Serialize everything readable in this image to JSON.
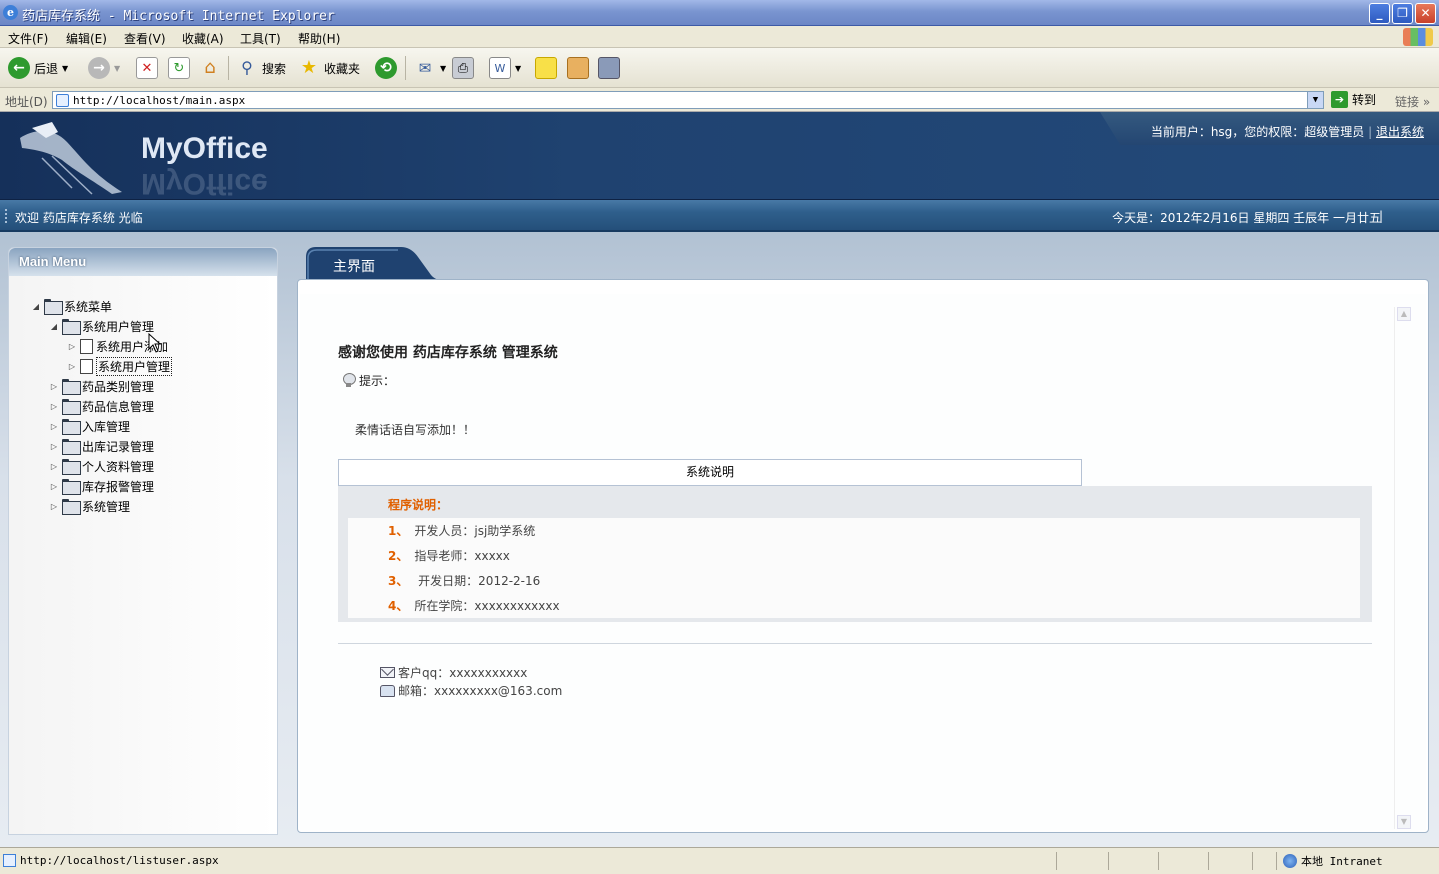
{
  "window": {
    "title": "药店库存系统 - Microsoft Internet Explorer"
  },
  "menubar": {
    "items": [
      "文件(F)",
      "编辑(E)",
      "查看(V)",
      "收藏(A)",
      "工具(T)",
      "帮助(H)"
    ]
  },
  "toolbar": {
    "back_label": "后退",
    "search_label": "搜索",
    "favorites_label": "收藏夹"
  },
  "address": {
    "label": "地址(D)",
    "url": "http://localhost/main.aspx",
    "go_label": "转到",
    "links_label": "链接"
  },
  "header": {
    "brand": "MyOffice",
    "user_info": "当前用户：hsg，您的权限：超级管理员",
    "logout_label": "退出系统"
  },
  "welcome": {
    "text": "欢迎 药店库存系统 光临",
    "date": "今天是：2012年2月16日 星期四 壬辰年 一月廿五"
  },
  "sidebar": {
    "title": "Main Menu",
    "tree": [
      {
        "label": "系统菜单"
      },
      {
        "label": "系统用户管理"
      },
      {
        "label": "系统用户添加"
      },
      {
        "label": "系统用户管理"
      },
      {
        "label": "药品类别管理"
      },
      {
        "label": "药品信息管理"
      },
      {
        "label": "入库管理"
      },
      {
        "label": "出库记录管理"
      },
      {
        "label": "个人资料管理"
      },
      {
        "label": "库存报警管理"
      },
      {
        "label": "系统管理"
      }
    ]
  },
  "main": {
    "tab_label": "主界面",
    "thanks": "感谢您使用 药店库存系统 管理系统",
    "tip_label": "提示：",
    "note": "柔情话语自写添加！！",
    "sys_desc_label": "系统说明",
    "program_heading": "程序说明：",
    "program_items": [
      {
        "num": "1、",
        "text": "开发人员：jsj助学系统"
      },
      {
        "num": "2、",
        "text": "指导老师：xxxxx"
      },
      {
        "num": "3、",
        "text": " 开发日期：2012-2-16"
      },
      {
        "num": "4、",
        "text": "所在学院：xxxxxxxxxxxx"
      }
    ],
    "contact_qq": "客户qq：xxxxxxxxxxx",
    "contact_email": "邮箱：xxxxxxxxx@163.com"
  },
  "status": {
    "url": "http://localhost/listuser.aspx",
    "zone": "本地 Intranet"
  },
  "colors": {
    "accent_orange": "#e06000",
    "header_blue": "#1f4270"
  }
}
